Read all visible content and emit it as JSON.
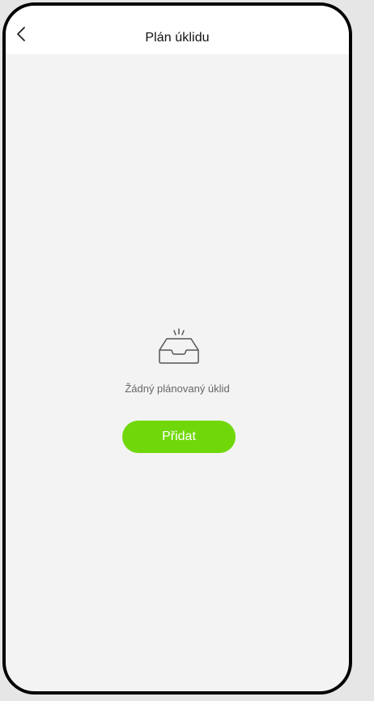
{
  "header": {
    "title": "Plán úklidu",
    "back_icon": "chevron-left-icon"
  },
  "empty_state": {
    "icon": "empty-inbox-icon",
    "message": "Žádný plánovaný úklid",
    "button_label": "Přidat"
  },
  "colors": {
    "accent": "#70d80a",
    "background": "#f3f3f3",
    "header_bg": "#ffffff",
    "frame": "#000000"
  }
}
